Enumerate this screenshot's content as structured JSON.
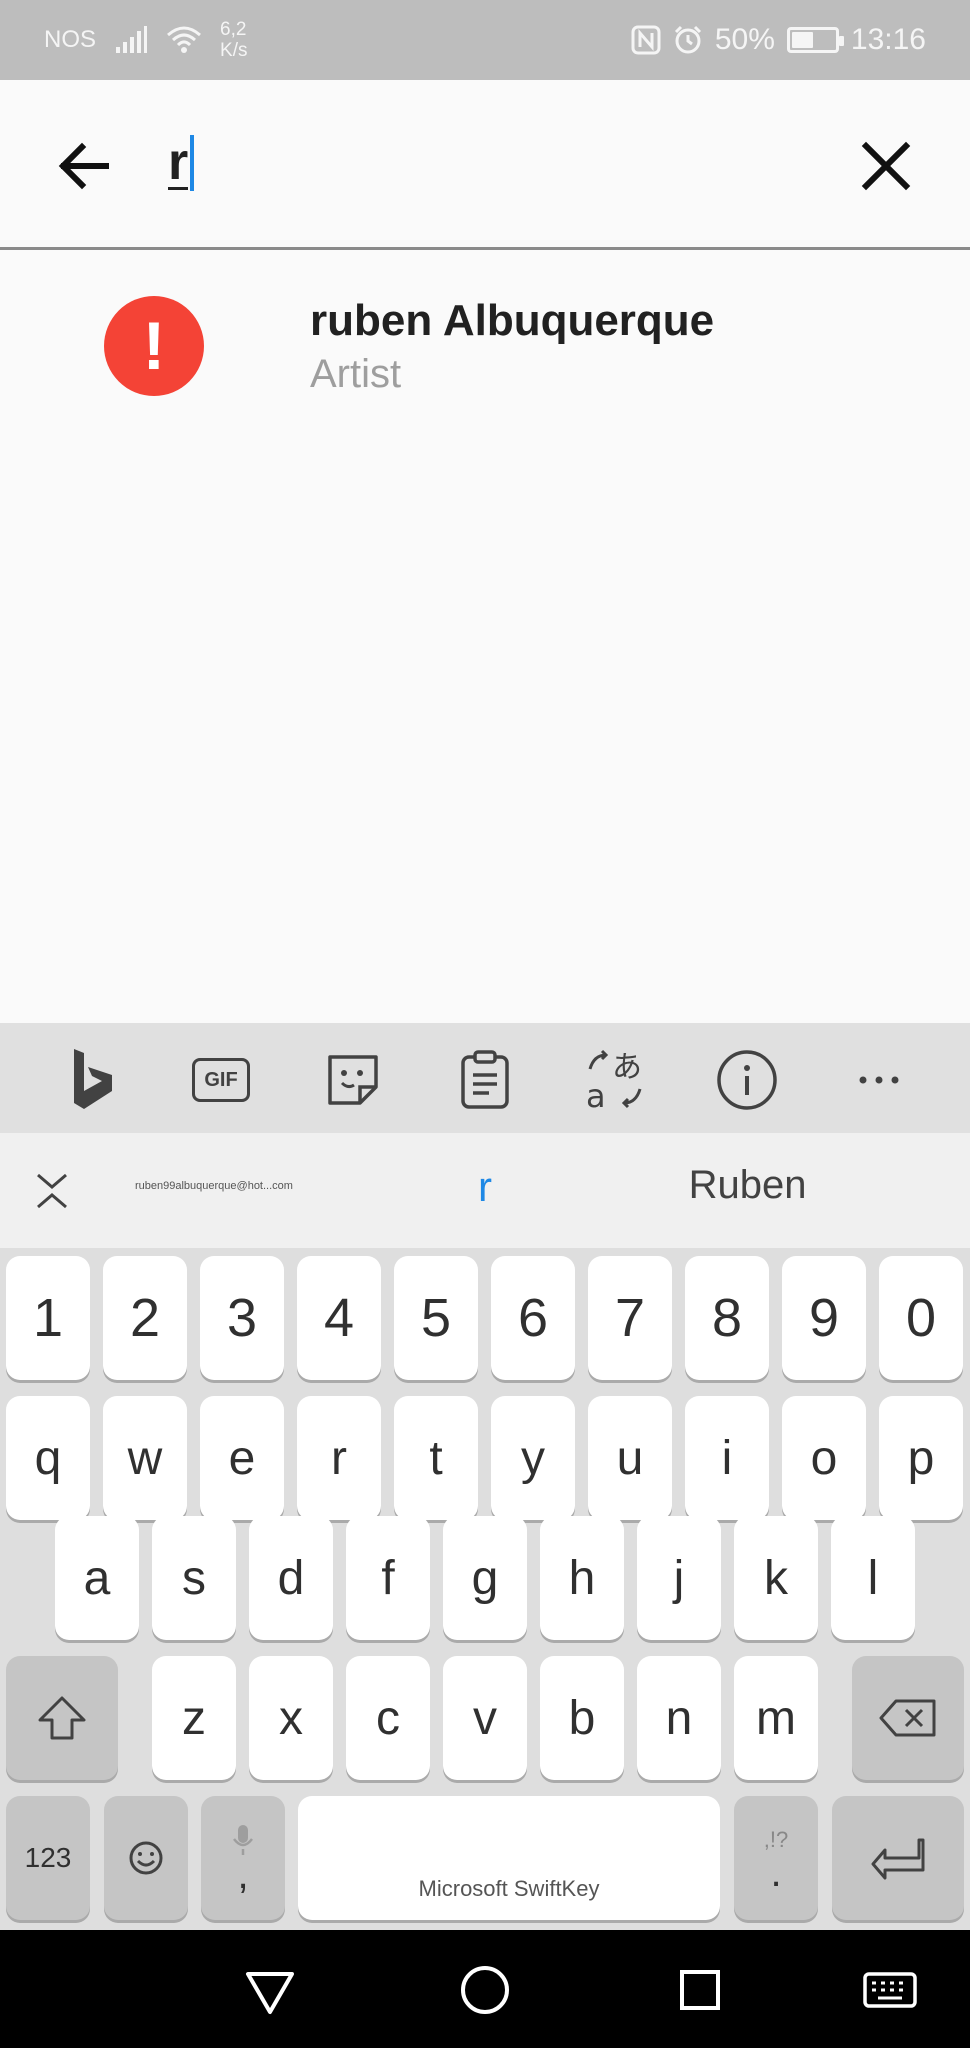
{
  "status_bar": {
    "carrier": "NOS",
    "speed_value": "6,2",
    "speed_unit": "K/s",
    "battery": "50%",
    "battery_level": 0.5,
    "time": "13:16"
  },
  "search": {
    "query": "r"
  },
  "results": [
    {
      "title": "ruben Albuquerque",
      "subtitle": "Artist",
      "icon": "alert-icon"
    }
  ],
  "keyboard": {
    "toolbar_icons": [
      "bing-icon",
      "gif-icon",
      "sticker-icon",
      "clipboard-icon",
      "translate-icon",
      "info-icon",
      "more-icon"
    ],
    "gif_label": "GIF",
    "suggestions": {
      "left": "ruben99albuquerque@hot...com",
      "middle": "r",
      "right": "Ruben"
    },
    "rows": {
      "numbers": [
        "1",
        "2",
        "3",
        "4",
        "5",
        "6",
        "7",
        "8",
        "9",
        "0"
      ],
      "row1": [
        "q",
        "w",
        "e",
        "r",
        "t",
        "y",
        "u",
        "i",
        "o",
        "p"
      ],
      "row2": [
        "a",
        "s",
        "d",
        "f",
        "g",
        "h",
        "j",
        "k",
        "l"
      ],
      "row3": [
        "z",
        "x",
        "c",
        "v",
        "b",
        "n",
        "m"
      ]
    },
    "num_key": "123",
    "comma": ",",
    "period": ".",
    "punct_hint": ",!?",
    "space_label": "Microsoft SwiftKey"
  },
  "colors": {
    "accent": "#1e88e5",
    "alert": "#f44336",
    "status_bar": "#bdbdbd"
  }
}
